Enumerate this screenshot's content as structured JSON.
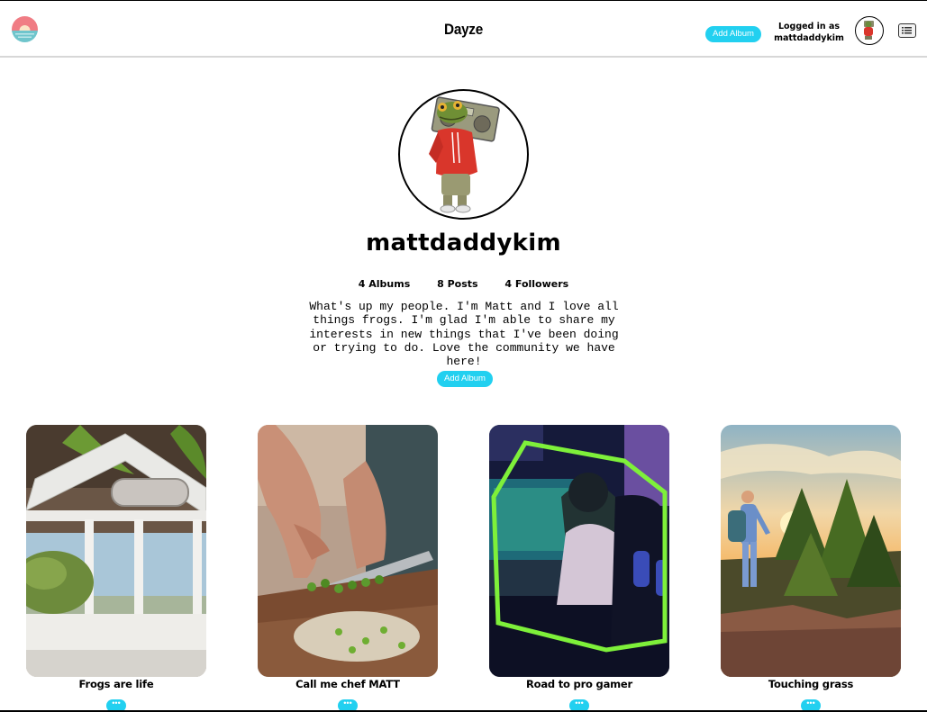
{
  "header": {
    "brand": "Dayze",
    "add_album_label": "Add Album",
    "logged_in_label": "Logged in as",
    "logged_in_user": "mattdaddykim"
  },
  "profile": {
    "username": "mattdaddykim",
    "stats": {
      "albums": "4 Albums",
      "posts": "8 Posts",
      "followers": "4 Followers"
    },
    "bio": "What's up my people. I'm Matt and I love all things frogs. I'm glad I'm able to share my interests in new things that I've been doing or trying to do. Love the community we have here!",
    "add_album_label": "Add Album"
  },
  "albums": [
    {
      "title": "Frogs are life",
      "more_label": "•••"
    },
    {
      "title": "Call me chef MATT",
      "more_label": "•••"
    },
    {
      "title": "Road to pro gamer",
      "more_label": "•••"
    },
    {
      "title": "Touching grass",
      "more_label": "•••"
    }
  ],
  "colors": {
    "accent": "#22d0f0",
    "header_border": "#d7d7d7"
  },
  "icons": {
    "logo": "sunset-logo-icon",
    "menu": "list-menu-icon"
  }
}
